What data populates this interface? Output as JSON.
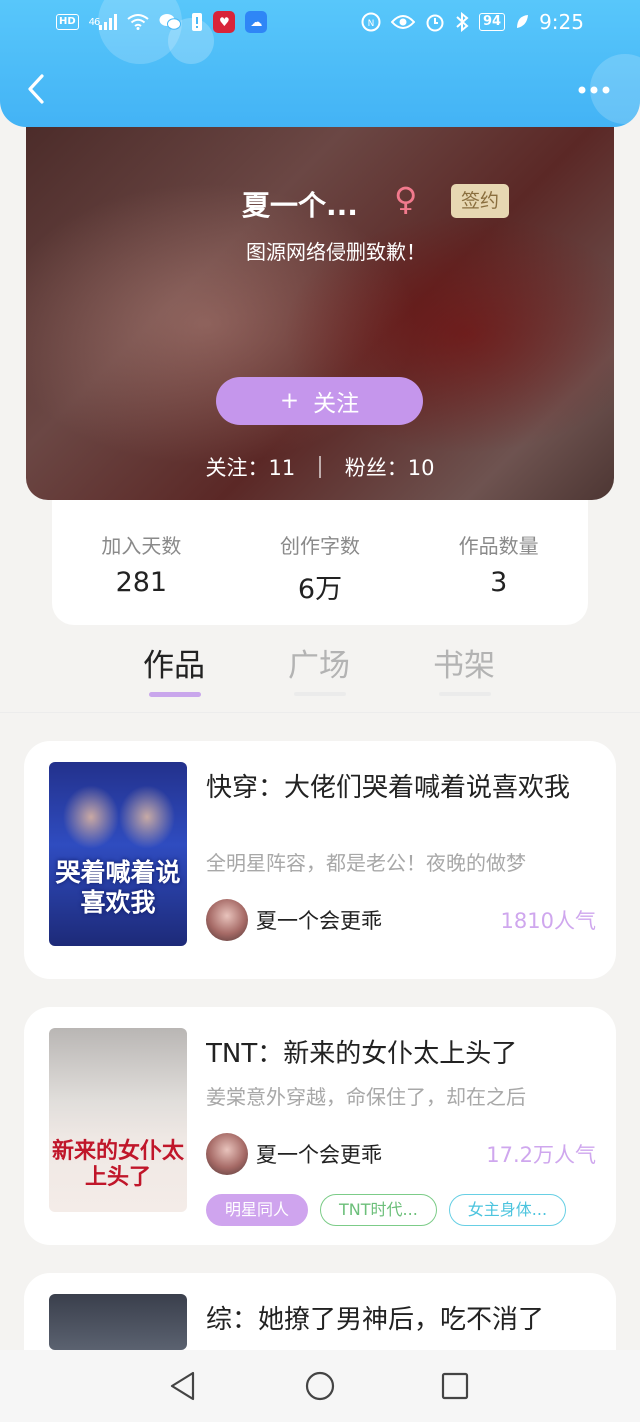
{
  "status_bar": {
    "hd": "HD",
    "network": "46",
    "battery": "94",
    "time": "9:25"
  },
  "header": {
    "back_icon": "chevron-left-icon",
    "more_icon": "more-dots-icon"
  },
  "profile": {
    "name": "夏一个...",
    "gender_symbol": "♀",
    "sign_badge": "签约",
    "description": "图源网络侵删致歉！",
    "follow_plus": "+",
    "follow_label": "关注",
    "following_label": "关注：11",
    "fans_label": "粉丝：10"
  },
  "stats": [
    {
      "label": "加入天数",
      "value": "281"
    },
    {
      "label": "创作字数",
      "value": "6万"
    },
    {
      "label": "作品数量",
      "value": "3"
    }
  ],
  "tabs": [
    {
      "label": "作品",
      "active": true
    },
    {
      "label": "广场",
      "active": false
    },
    {
      "label": "书架",
      "active": false
    }
  ],
  "books": [
    {
      "title": "快穿：大佬们哭着喊着说喜欢我",
      "description": "全明星阵容，都是老公！夜晚的做梦",
      "author": "夏一个会更乖",
      "popularity": "1810人气",
      "cover_text": "哭着喊着说喜欢我",
      "tags": []
    },
    {
      "title": "TNT：新来的女仆太上头了",
      "description": "姜棠意外穿越，命保住了，却在之后",
      "author": "夏一个会更乖",
      "popularity": "17.2万人气",
      "cover_text": "新来的女仆太上头了",
      "tags": [
        "明星同人",
        "TNT时代...",
        "女主身体..."
      ]
    },
    {
      "title": "综：她撩了男神后，吃不消了",
      "description": "",
      "author": "",
      "popularity": "",
      "cover_text": "",
      "tags": []
    }
  ],
  "colors": {
    "header_blue": "#4bbaf7",
    "accent_purple": "#c596ec",
    "tag_green": "#6cbf7a",
    "tag_cyan": "#4cc4de",
    "gender_pink": "#f27a8d"
  }
}
